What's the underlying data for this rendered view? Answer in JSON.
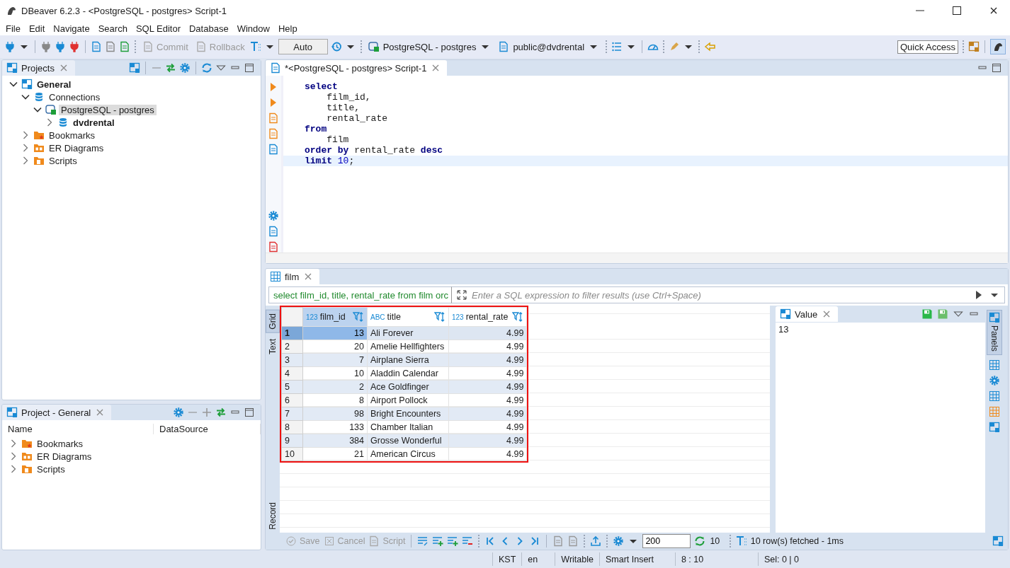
{
  "window": {
    "title": "DBeaver 6.2.3 - <PostgreSQL - postgres> Script-1"
  },
  "menu": [
    "File",
    "Edit",
    "Navigate",
    "Search",
    "SQL Editor",
    "Database",
    "Window",
    "Help"
  ],
  "toolbar": {
    "buttons": [
      {
        "label": "Commit",
        "disabled": true
      },
      {
        "label": "Rollback",
        "disabled": true
      }
    ],
    "mode": "Auto",
    "connection": "PostgreSQL - postgres",
    "schema": "public@dvdrental",
    "quick_access": "Quick Access"
  },
  "projects": {
    "title": "Projects",
    "tree": [
      {
        "label": "General",
        "kind": "project",
        "bold": true,
        "expanded": true,
        "selected": false,
        "children": [
          {
            "label": "Connections",
            "kind": "connections",
            "bold": false,
            "expanded": true,
            "selected": false,
            "children": [
              {
                "label": "PostgreSQL - postgres",
                "kind": "postgres",
                "bold": false,
                "expanded": true,
                "selected": true,
                "children": [
                  {
                    "label": "dvdrental",
                    "kind": "database",
                    "bold": true,
                    "expanded": false,
                    "selected": false
                  }
                ]
              }
            ]
          },
          {
            "label": "Bookmarks",
            "kind": "bookmarks",
            "bold": false,
            "expanded": false,
            "selected": false
          },
          {
            "label": "ER Diagrams",
            "kind": "diagrams",
            "bold": false,
            "expanded": false,
            "selected": false
          },
          {
            "label": "Scripts",
            "kind": "scripts",
            "bold": false,
            "expanded": false,
            "selected": false
          }
        ]
      }
    ]
  },
  "project_panel": {
    "title": "Project - General",
    "columns": [
      "Name",
      "DataSource"
    ],
    "items": [
      {
        "label": "Bookmarks",
        "kind": "bookmarks",
        "expanded": false
      },
      {
        "label": "ER Diagrams",
        "kind": "diagrams",
        "expanded": false
      },
      {
        "label": "Scripts",
        "kind": "scripts",
        "expanded": false
      }
    ]
  },
  "editor": {
    "tab": "*<PostgreSQL - postgres> Script-1",
    "lines": [
      {
        "current": false,
        "tokens": [
          {
            "text": "select",
            "kind": "keyword"
          }
        ]
      },
      {
        "current": false,
        "tokens": [
          {
            "text": "    film_id,",
            "kind": "plain"
          }
        ]
      },
      {
        "current": false,
        "tokens": [
          {
            "text": "    title,",
            "kind": "plain"
          }
        ]
      },
      {
        "current": false,
        "tokens": [
          {
            "text": "    rental_rate",
            "kind": "plain"
          }
        ]
      },
      {
        "current": false,
        "tokens": [
          {
            "text": "from",
            "kind": "keyword"
          }
        ]
      },
      {
        "current": false,
        "tokens": [
          {
            "text": "    film",
            "kind": "plain"
          }
        ]
      },
      {
        "current": false,
        "tokens": [
          {
            "text": "order by",
            "kind": "keyword"
          },
          {
            "text": " rental_rate ",
            "kind": "plain"
          },
          {
            "text": "desc",
            "kind": "keyword"
          }
        ]
      },
      {
        "current": true,
        "tokens": [
          {
            "text": "limit",
            "kind": "keyword"
          },
          {
            "text": " 10",
            "kind": "number"
          },
          {
            "text": ";",
            "kind": "plain"
          }
        ]
      }
    ]
  },
  "results": {
    "tab": "film",
    "query": "select film_id, title, rental_rate from film orc",
    "filter_placeholder": "Enter a SQL expression to filter results (use Ctrl+Space)",
    "side_tabs": [
      {
        "label": "Grid",
        "selected": true
      },
      {
        "label": "Text",
        "selected": false
      },
      {
        "label": "Record",
        "selected": false
      }
    ],
    "columns": [
      {
        "type": "123",
        "label": "film_id"
      },
      {
        "type": "ABC",
        "label": "title"
      },
      {
        "type": "123",
        "label": "rental_rate"
      }
    ],
    "rows": [
      {
        "n": "1",
        "selected": true,
        "cells": [
          "13",
          "Ali Forever",
          "4.99"
        ]
      },
      {
        "n": "2",
        "selected": false,
        "cells": [
          "20",
          "Amelie Hellfighters",
          "4.99"
        ]
      },
      {
        "n": "3",
        "selected": false,
        "cells": [
          "7",
          "Airplane Sierra",
          "4.99"
        ]
      },
      {
        "n": "4",
        "selected": false,
        "cells": [
          "10",
          "Aladdin Calendar",
          "4.99"
        ]
      },
      {
        "n": "5",
        "selected": false,
        "cells": [
          "2",
          "Ace Goldfinger",
          "4.99"
        ]
      },
      {
        "n": "6",
        "selected": false,
        "cells": [
          "8",
          "Airport Pollock",
          "4.99"
        ]
      },
      {
        "n": "7",
        "selected": false,
        "cells": [
          "98",
          "Bright Encounters",
          "4.99"
        ]
      },
      {
        "n": "8",
        "selected": false,
        "cells": [
          "133",
          "Chamber Italian",
          "4.99"
        ]
      },
      {
        "n": "9",
        "selected": false,
        "cells": [
          "384",
          "Grosse Wonderful",
          "4.99"
        ]
      },
      {
        "n": "10",
        "selected": false,
        "cells": [
          "21",
          "American Circus",
          "4.99"
        ]
      }
    ],
    "value_panel": {
      "title": "Value",
      "value": "13"
    },
    "panels_tab": "Panels",
    "bottom_buttons": [
      {
        "label": "Save",
        "disabled": true
      },
      {
        "label": "Cancel",
        "disabled": true
      },
      {
        "label": "Script",
        "disabled": true
      }
    ],
    "fetch_size": "200",
    "row_count": "10",
    "fetch_status": "10 row(s) fetched - 1ms"
  },
  "status_bar": [
    "KST",
    "en",
    "Writable",
    "Smart Insert",
    "8 : 10",
    "Sel: 0 | 0"
  ]
}
